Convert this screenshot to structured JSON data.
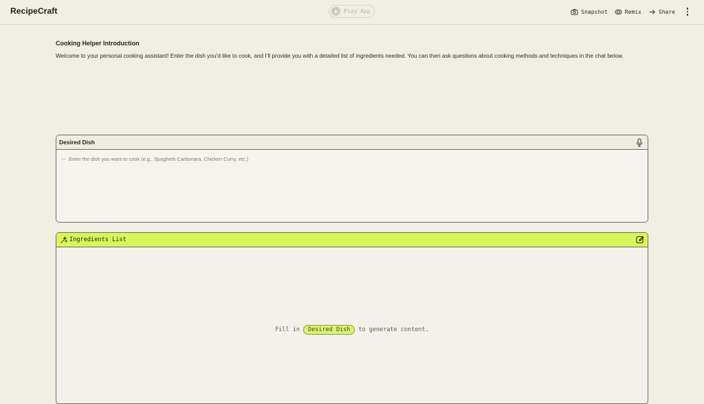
{
  "app": {
    "title": "RecipeCraft",
    "play_label": "Play App"
  },
  "top_actions": {
    "snapshot": "Snapshot",
    "remix": "Remix",
    "share": "Share"
  },
  "intro": {
    "title": "Cooking Helper Introduction",
    "body": "Welcome to your personal cooking assistant! Enter the dish you'd like to cook, and I'll provide you with a detailed list of ingredients needed. You can then ask questions about cooking methods and techniques in the chat below."
  },
  "input_card": {
    "label": "Desired Dish",
    "placeholder": "Enter the dish you want to cook (e.g., Spaghetti Carbonara, Chicken Curry, etc.)",
    "value": ""
  },
  "output_card": {
    "title": "Ingredients List",
    "empty_prefix": "Fill in",
    "empty_chip": "Desired Dish",
    "empty_suffix": "to generate content."
  },
  "colors": {
    "background": "#f1eee3",
    "accent": "#d8f55c",
    "chip_bg": "#dcf27a",
    "border": "#6f6c63"
  },
  "icons": {
    "play": "play-icon",
    "snapshot": "camera-icon",
    "remix": "remix-icon",
    "share": "arrow-right-icon",
    "menu": "kebab-menu-icon",
    "mic": "microphone-icon",
    "output": "sparkle-icon",
    "edit": "edit-icon"
  }
}
